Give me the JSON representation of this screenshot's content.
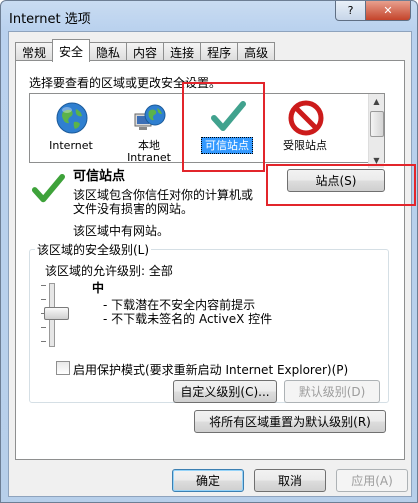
{
  "window": {
    "title": "Internet 选项",
    "help_glyph": "?",
    "close_glyph": "✕"
  },
  "tabs": [
    {
      "label": "常规"
    },
    {
      "label": "安全"
    },
    {
      "label": "隐私"
    },
    {
      "label": "内容"
    },
    {
      "label": "连接"
    },
    {
      "label": "程序"
    },
    {
      "label": "高级"
    }
  ],
  "active_tab": "安全",
  "security": {
    "select_zone_prompt": "选择要查看的区域或更改安全设置。",
    "zones": [
      {
        "label_line1": "Internet",
        "label_line2": "",
        "icon": "globe-icon"
      },
      {
        "label_line1": "本地",
        "label_line2": "Intranet",
        "icon": "intranet-globe-icon"
      },
      {
        "label_line1": "可信站点",
        "label_line2": "",
        "icon": "check-icon",
        "selected": true
      },
      {
        "label_line1": "受限站点",
        "label_line2": "",
        "icon": "no-entry-icon"
      }
    ],
    "zone_title": "可信站点",
    "zone_desc": "该区域包含你信任对你的计算机或文件没有损害的网站。",
    "zone_desc_line1": "该区域包含你信任对你的计算机或",
    "zone_desc_line2": "文件没有损害的网站。",
    "zone_has_sites": "该区域中有网站。",
    "sites_button": "站点(S)",
    "level_group_title": "该区域的安全级别(L)",
    "allowed_levels": "该区域的允许级别: 全部",
    "level_name": "中",
    "level_bullets": [
      "- 下载潜在不安全内容前提示",
      "- 不下载未签名的 ActiveX 控件"
    ],
    "protected_mode_label": "启用保护模式(要求重新启动 Internet Explorer)(P)",
    "protected_mode_checked": false,
    "custom_level_button": "自定义级别(C)...",
    "default_level_button": "默认级别(D)",
    "reset_all_button": "将所有区域重置为默认级别(R)"
  },
  "footer": {
    "ok": "确定",
    "cancel": "取消",
    "apply": "应用(A)"
  },
  "colors": {
    "highlight_box": "#e2252b",
    "selection": "#3399ff"
  }
}
